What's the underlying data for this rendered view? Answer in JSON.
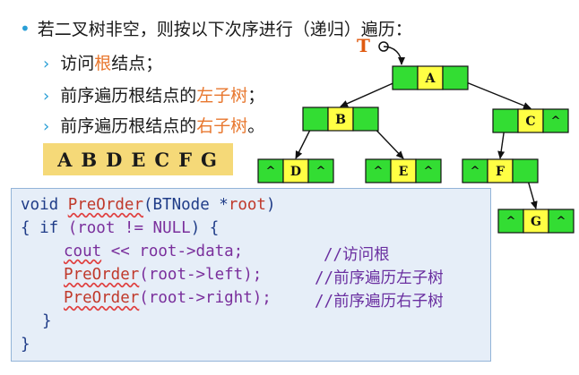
{
  "bullets": {
    "main": "若二叉树非空，则按以下次序进行（递归）遍历：",
    "item1_pre": "访问",
    "item1_hl": "根",
    "item1_post": "结点；",
    "item2_pre": "前序遍历根结点的",
    "item2_hl": "左子树",
    "item2_post": "；",
    "item3_pre": "前序遍历根结点的",
    "item3_hl": "右子树",
    "item3_post": "。"
  },
  "result": [
    "A",
    "B",
    "D",
    "E",
    "C",
    "F",
    "G"
  ],
  "code": {
    "l1_void": "void ",
    "l1_fn": "PreOrder",
    "l1_args": "(BTNode *",
    "l1_root": "root",
    "l1_close": ")",
    "l2_brace": "{ ",
    "l2_if": "if",
    "l2_open": " (",
    "l2_root": "root",
    "l2_ne": " != ",
    "l2_null": "NULL",
    "l2_close": ") {",
    "l3_cout": "cout",
    "l3_op": " << ",
    "l3_expr": "root->data;",
    "l3_comment": "//访问根",
    "l4_fn": "PreOrder",
    "l4_args": "(root->left);",
    "l4_comment": "//前序遍历左子树",
    "l5_fn": "PreOrder",
    "l5_args": "(root->right);",
    "l5_comment": "//前序遍历右子树",
    "l6": "}",
    "l7": "}"
  },
  "tree": {
    "root_pointer_label": "T",
    "null_marker": "^",
    "nodes": [
      "A",
      "B",
      "C",
      "D",
      "E",
      "F",
      "G"
    ]
  },
  "colors": {
    "node_fill": "#33dd33",
    "node_data_fill": "#ffff44",
    "pointer_label": "#e05a10",
    "bullet_accent": "#2a9fd6",
    "highlight": "#e8772e",
    "result_bg": "#f5d978",
    "code_bg": "#e6eef8"
  }
}
